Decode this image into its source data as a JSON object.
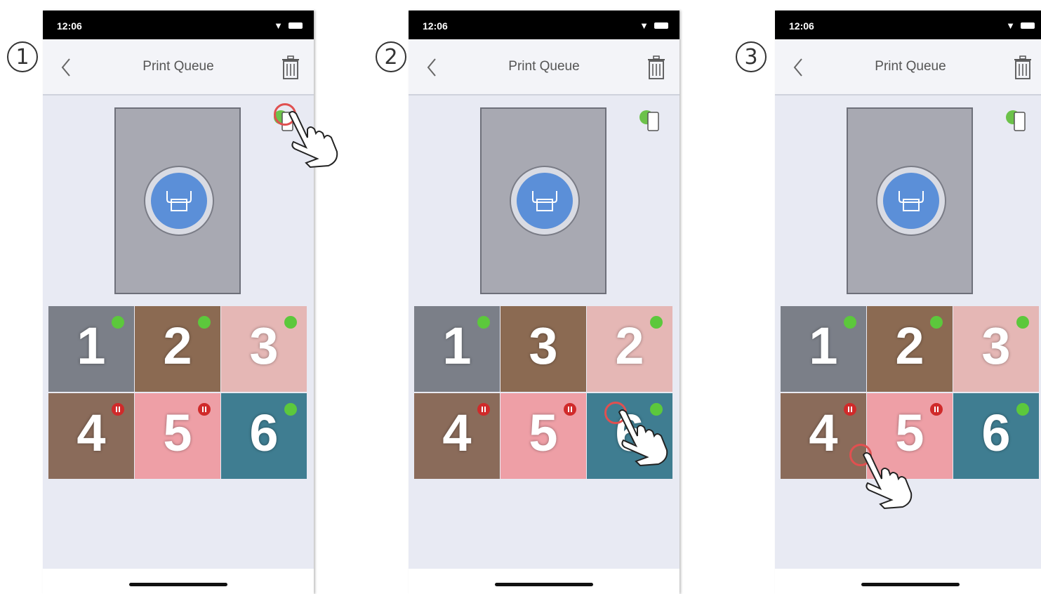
{
  "steps": [
    "1",
    "2",
    "3"
  ],
  "phone": {
    "status_time": "12:06",
    "title": "Print Queue"
  },
  "screens": [
    {
      "tiles": [
        {
          "num": "1",
          "badge": "green",
          "bg": "#7b7f88"
        },
        {
          "num": "2",
          "badge": "green",
          "bg": "#8b6a52"
        },
        {
          "num": "3",
          "badge": "green",
          "bg": "#e5b7b5"
        },
        {
          "num": "4",
          "badge": "red",
          "bg": "#8a6b5a"
        },
        {
          "num": "5",
          "badge": "red",
          "bg": "#ee9fa6"
        },
        {
          "num": "6",
          "badge": "green",
          "bg": "#3f7d91"
        }
      ]
    },
    {
      "tiles": [
        {
          "num": "1",
          "badge": "green",
          "bg": "#7b7f88"
        },
        {
          "num": "3",
          "badge": "none",
          "bg": "#8b6a52"
        },
        {
          "num": "2",
          "badge": "green",
          "bg": "#e5b7b5"
        },
        {
          "num": "4",
          "badge": "red",
          "bg": "#8a6b5a"
        },
        {
          "num": "5",
          "badge": "red",
          "bg": "#ee9fa6"
        },
        {
          "num": "6",
          "badge": "green",
          "bg": "#3f7d91"
        }
      ]
    },
    {
      "tiles": [
        {
          "num": "1",
          "badge": "green",
          "bg": "#7b7f88"
        },
        {
          "num": "2",
          "badge": "green",
          "bg": "#8b6a52"
        },
        {
          "num": "3",
          "badge": "green",
          "bg": "#e5b7b5"
        },
        {
          "num": "4",
          "badge": "red",
          "bg": "#8a6b5a"
        },
        {
          "num": "5",
          "badge": "red",
          "bg": "#ee9fa6"
        },
        {
          "num": "6",
          "badge": "green",
          "bg": "#3f7d91"
        }
      ]
    }
  ],
  "colors": {
    "accent_blue": "#5b8fd8",
    "status_green": "#5cc83c",
    "status_red": "#d02a2a",
    "tap_ring": "#e05050"
  }
}
